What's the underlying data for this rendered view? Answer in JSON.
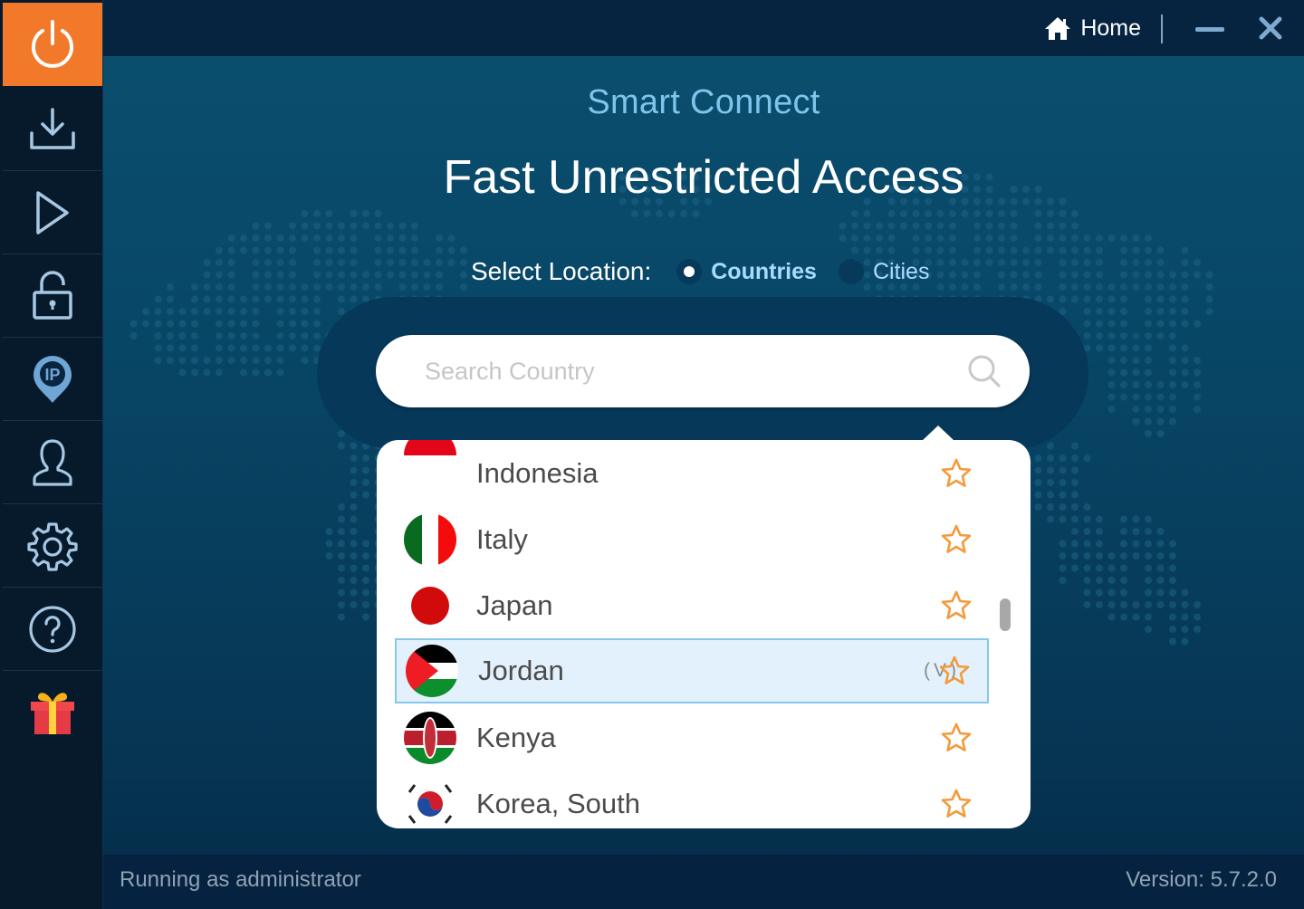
{
  "sidebar": {
    "items": [
      {
        "name": "power",
        "icon": "power-icon",
        "active": true
      },
      {
        "name": "download",
        "icon": "download-icon"
      },
      {
        "name": "play",
        "icon": "play-icon"
      },
      {
        "name": "lock",
        "icon": "unlock-icon"
      },
      {
        "name": "ip",
        "icon": "ip-location-icon"
      },
      {
        "name": "account",
        "icon": "user-icon"
      },
      {
        "name": "settings",
        "icon": "gear-icon"
      },
      {
        "name": "help",
        "icon": "help-icon"
      },
      {
        "name": "gift",
        "icon": "gift-icon"
      }
    ]
  },
  "titlebar": {
    "home_label": "Home",
    "home_icon": "home-icon",
    "minimize_icon": "minimize-icon",
    "close_icon": "close-icon"
  },
  "main": {
    "subtitle": "Smart Connect",
    "headline": "Fast Unrestricted Access",
    "location": {
      "label": "Select Location:",
      "options": [
        {
          "label": "Countries",
          "selected": true
        },
        {
          "label": "Cities",
          "selected": false
        }
      ]
    },
    "search": {
      "placeholder": "Search Country",
      "value": ""
    },
    "countries": [
      {
        "name": "Indonesia",
        "tag": "",
        "selected": false,
        "favorite": false
      },
      {
        "name": "Italy",
        "tag": "",
        "selected": false,
        "favorite": false
      },
      {
        "name": "Japan",
        "tag": "",
        "selected": false,
        "favorite": false
      },
      {
        "name": "Jordan",
        "tag": "(V)",
        "selected": true,
        "favorite": false
      },
      {
        "name": "Kenya",
        "tag": "",
        "selected": false,
        "favorite": false
      },
      {
        "name": "Korea, South",
        "tag": "",
        "selected": false,
        "favorite": false
      }
    ]
  },
  "footer": {
    "status": "Running as administrator",
    "version": "Version:  5.7.2.0"
  },
  "colors": {
    "accent": "#f2792a",
    "sidebar_bg": "#061a2c",
    "main_bg": "#0a4e6e",
    "subtitle": "#7ec4ec",
    "star": "#f49a3c",
    "selected_row": "#e2f1fb"
  }
}
